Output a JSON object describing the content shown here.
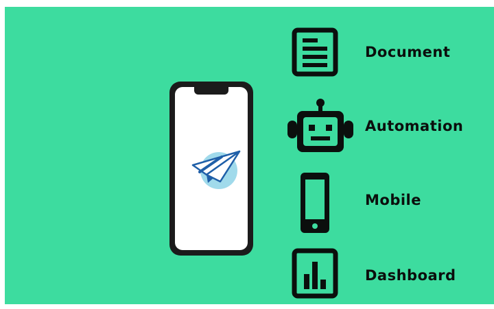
{
  "colors": {
    "background": "#3ddc9f",
    "icon": "#0b0f0d",
    "phone_body": "#1b1b1b",
    "screen": "#ffffff",
    "logo_circle": "#8fd3e8",
    "logo_plane": "#1f5fa8"
  },
  "phone": {
    "logo_icon": "paper-plane-icon"
  },
  "features": [
    {
      "label": "Document",
      "icon": "document-icon"
    },
    {
      "label": "Automation",
      "icon": "robot-icon"
    },
    {
      "label": "Mobile",
      "icon": "smartphone-icon"
    },
    {
      "label": "Dashboard",
      "icon": "bar-chart-icon"
    }
  ]
}
